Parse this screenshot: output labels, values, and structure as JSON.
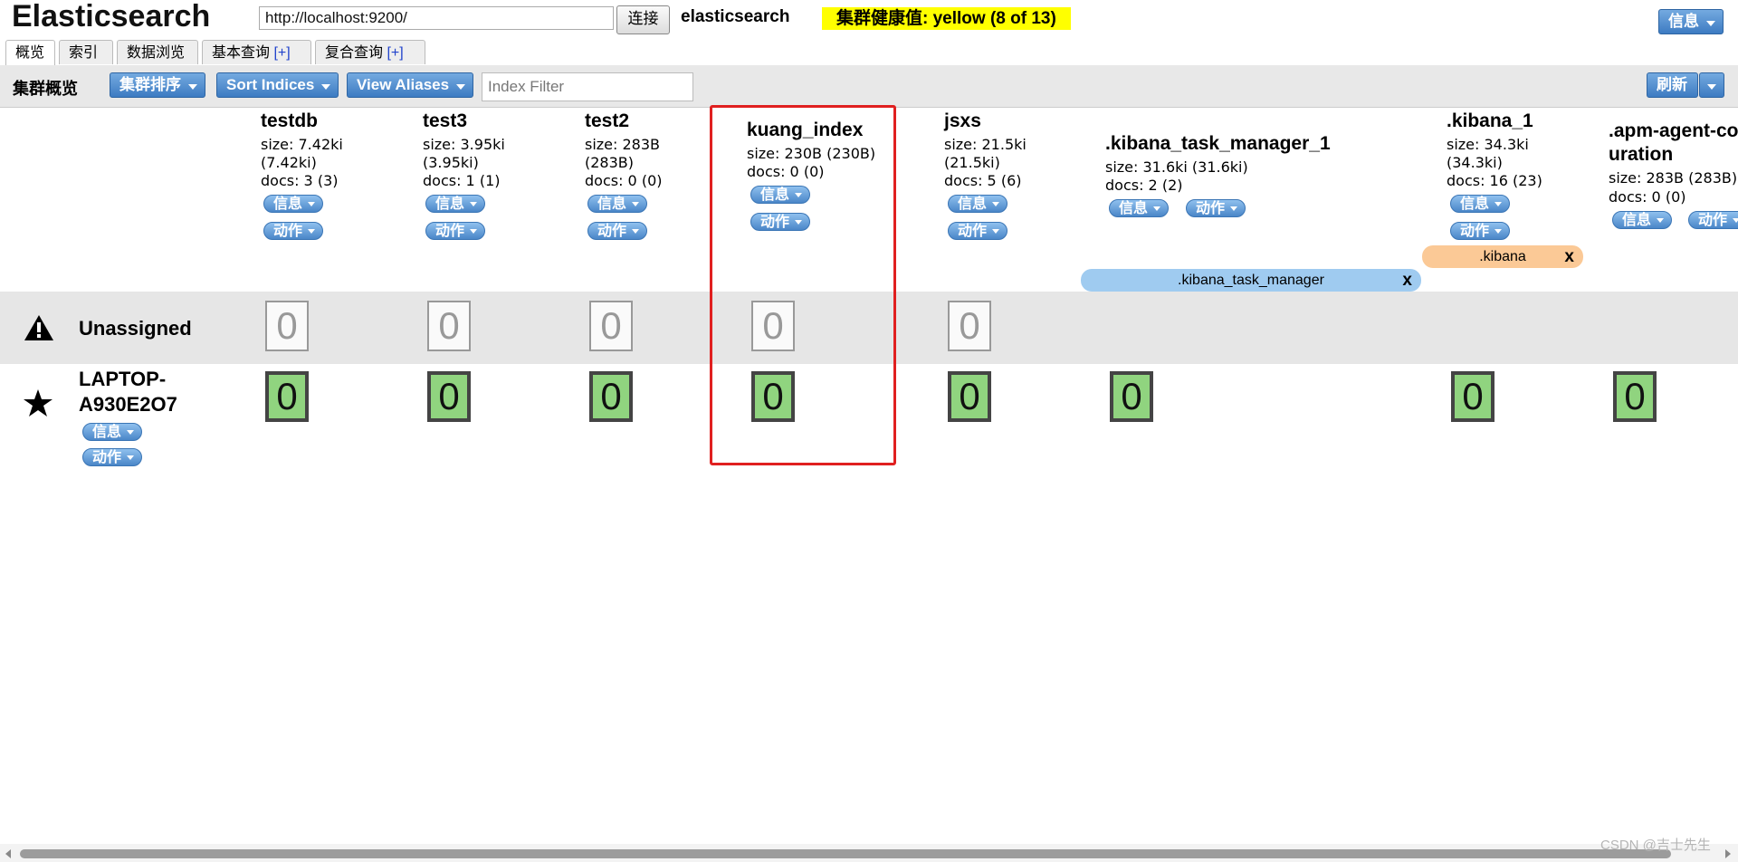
{
  "header": {
    "logo": "Elasticsearch",
    "connection_url": "http://localhost:9200/",
    "connect_label": "连接",
    "cluster_name": "elasticsearch",
    "health_text": "集群健康值: yellow (8 of 13)",
    "info_label": "信息"
  },
  "tabs": [
    {
      "label": "概览",
      "plus": ""
    },
    {
      "label": "索引",
      "plus": ""
    },
    {
      "label": "数据浏览",
      "plus": ""
    },
    {
      "label": "基本查询",
      "plus": "[+]"
    },
    {
      "label": "复合查询",
      "plus": "[+]"
    }
  ],
  "toolbar": {
    "title": "集群概览",
    "sort_cluster": "集群排序",
    "sort_indices": "Sort Indices",
    "view_aliases": "View Aliases",
    "index_filter_placeholder": "Index Filter",
    "refresh": "刷新"
  },
  "index_buttons": {
    "info": "信息",
    "action": "动作"
  },
  "indices": [
    {
      "name": "testdb",
      "size1": "size: 7.42ki",
      "size2": "(7.42ki)",
      "docs": "docs: 3 (3)"
    },
    {
      "name": "test3",
      "size1": "size: 3.95ki",
      "size2": "(3.95ki)",
      "docs": "docs: 1 (1)"
    },
    {
      "name": "test2",
      "size1": "size: 283B",
      "size2": "(283B)",
      "docs": "docs: 0 (0)"
    },
    {
      "name": "kuang_index",
      "size1": "size: 230B (230B)",
      "size2": "",
      "docs": "docs: 0 (0)"
    },
    {
      "name": "jsxs",
      "size1": "size: 21.5ki",
      "size2": "(21.5ki)",
      "docs": "docs: 5 (6)"
    },
    {
      "name": ".kibana_task_manager_1",
      "size1": "size: 31.6ki (31.6ki)",
      "size2": "",
      "docs": "docs: 2 (2)"
    },
    {
      "name": ".kibana_1",
      "size1": "size: 34.3ki",
      "size2": "(34.3ki)",
      "docs": "docs: 16 (23)"
    },
    {
      "name": ".apm-agent-configuration",
      "size1": "size: 283B (283B)",
      "size2": "",
      "docs": "docs: 0 (0)"
    }
  ],
  "aliases": [
    {
      "name": ".kibana",
      "close": "x"
    },
    {
      "name": ".kibana_task_manager",
      "close": "x"
    }
  ],
  "rows": {
    "unassigned": {
      "label": "Unassigned",
      "shards": [
        "0",
        "0",
        "0",
        "0",
        "0"
      ]
    },
    "node": {
      "label_line1": "LAPTOP-",
      "label_line2": "A930E2O7",
      "shards": [
        "0",
        "0",
        "0",
        "0",
        "0",
        "0",
        "0",
        "0"
      ]
    }
  },
  "watermark": "CSDN @吉士先生",
  "colors": {
    "health": "#ffff00",
    "shard_started": "#90d47f",
    "alias_kibana": "#fbc996",
    "alias_task": "#9fcbf0",
    "highlight": "#e02020"
  }
}
